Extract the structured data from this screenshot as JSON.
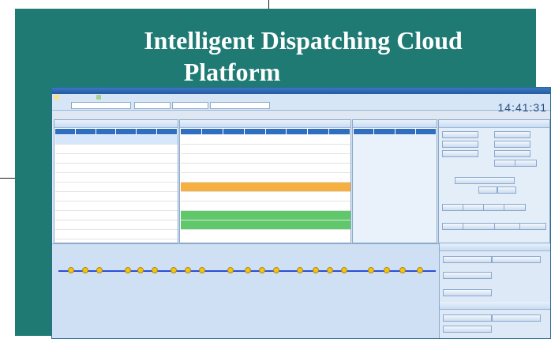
{
  "slide": {
    "title_line1": "Intelligent Dispatching  Cloud",
    "title_line2": "Platform"
  },
  "app": {
    "window_title": "",
    "tabs": [
      "",
      ""
    ],
    "clock": "14:41:31",
    "filter_values": [
      "",
      "",
      "",
      ""
    ],
    "panels": {
      "left_header": "",
      "mid_header": "",
      "right_header": ""
    },
    "table_left": {
      "rows": [
        {
          "no": "",
          "c2": "",
          "c3": "",
          "c4": "",
          "c5": "",
          "c6": ""
        },
        {
          "no": "",
          "c2": "",
          "c3": "",
          "c4": "",
          "c5": "",
          "c6": ""
        },
        {
          "no": "",
          "c2": "",
          "c3": "",
          "c4": "",
          "c5": "",
          "c6": ""
        },
        {
          "no": "",
          "c2": "",
          "c3": "",
          "c4": "",
          "c5": "",
          "c6": ""
        },
        {
          "no": "",
          "c2": "",
          "c3": "",
          "c4": "",
          "c5": "",
          "c6": ""
        },
        {
          "no": "",
          "c2": "",
          "c3": "",
          "c4": "",
          "c5": "",
          "c6": ""
        },
        {
          "no": "",
          "c2": "",
          "c3": "",
          "c4": "",
          "c5": "",
          "c6": ""
        },
        {
          "no": "",
          "c2": "",
          "c3": "",
          "c4": "",
          "c5": "",
          "c6": ""
        },
        {
          "no": "",
          "c2": "",
          "c3": "",
          "c4": "",
          "c5": "",
          "c6": ""
        },
        {
          "no": "",
          "c2": "",
          "c3": "",
          "c4": "",
          "c5": "",
          "c6": ""
        },
        {
          "no": "",
          "c2": "",
          "c3": "",
          "c4": "",
          "c5": "",
          "c6": ""
        },
        {
          "no": "",
          "c2": "",
          "c3": "",
          "c4": "",
          "c5": "",
          "c6": ""
        },
        {
          "no": "",
          "c2": "",
          "c3": "",
          "c4": "",
          "c5": "",
          "c6": ""
        },
        {
          "no": "",
          "c2": "",
          "c3": "",
          "c4": "",
          "c5": "",
          "c6": ""
        }
      ]
    },
    "row_colors": {
      "highlight_orange": "#f5b041",
      "highlight_green": "#5ec86a",
      "header_blue": "#2e6fc0",
      "route_blue": "#2a4fd6",
      "stop_yellow": "#f1c40f"
    }
  }
}
